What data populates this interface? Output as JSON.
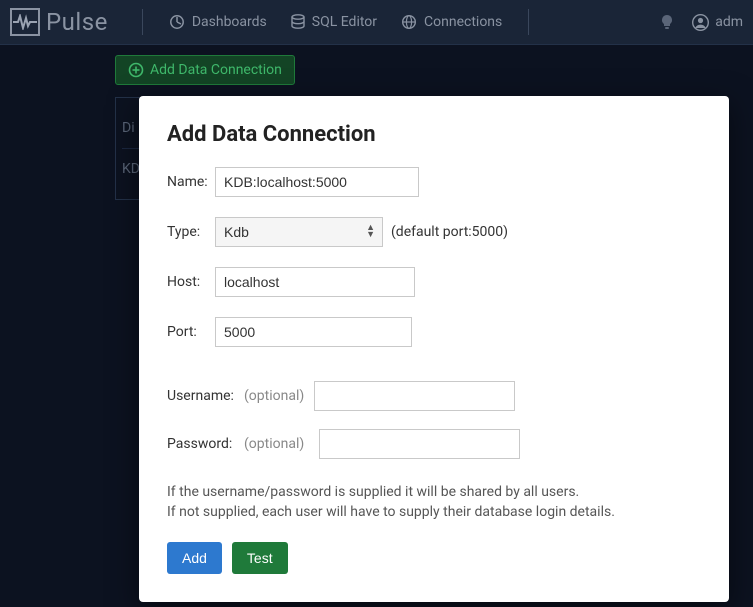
{
  "brand": {
    "name": "Pulse"
  },
  "nav": {
    "dashboards": "Dashboards",
    "sql_editor": "SQL Editor",
    "connections": "Connections",
    "user": "adm"
  },
  "page": {
    "add_connection_btn": "Add Data Connection"
  },
  "bg_list": {
    "row1": "Di",
    "row2": "KD"
  },
  "modal": {
    "title": "Add Data Connection",
    "labels": {
      "name": "Name:",
      "type": "Type:",
      "host": "Host:",
      "port": "Port:",
      "username": "Username:",
      "password": "Password:",
      "optional": "(optional)"
    },
    "values": {
      "name": "KDB:localhost:5000",
      "type": "Kdb",
      "host": "localhost",
      "port": "5000",
      "username": "",
      "password": ""
    },
    "type_hint": "(default port:5000)",
    "help_line1": "If the username/password is supplied it will be shared by all users.",
    "help_line2": "If not supplied, each user will have to supply their database login details.",
    "buttons": {
      "add": "Add",
      "test": "Test"
    }
  }
}
